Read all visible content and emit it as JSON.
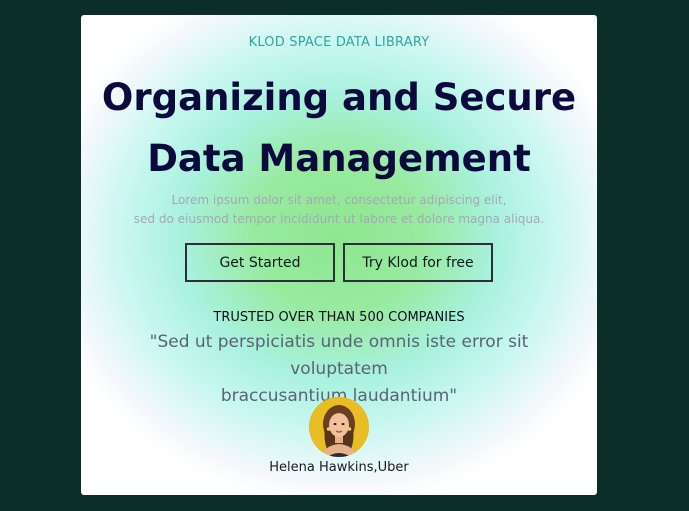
{
  "hero": {
    "eyebrow": "KLOD SPACE DATA LIBRARY",
    "headline_line1": "Organizing and Secure",
    "headline_line2": "Data Management",
    "lede_line1": "Lorem ipsum dolor sit amet, consectetur adipiscing elit,",
    "lede_line2": "sed do eiusmod tempor incididunt ut labore et dolore magna aliqua.",
    "buttons": [
      {
        "label": "Get Started"
      },
      {
        "label": "Try Klod for free"
      }
    ]
  },
  "testimonial": {
    "trusted_label": "TRUSTED OVER THAN 500 COMPANIES",
    "quote_line1": "\"Sed ut perspiciatis unde omnis iste error sit voluptatem",
    "quote_line2": "braccusantium laudantium\"",
    "author_name": "Helena Hawkins",
    "author_company": "Uber",
    "avatar_icon": "person-portrait"
  },
  "colors": {
    "page_background": "#0b2e28",
    "eyebrow": "#2fa6a0",
    "headline": "#0c0a3c",
    "avatar_background": "#e5b820"
  }
}
